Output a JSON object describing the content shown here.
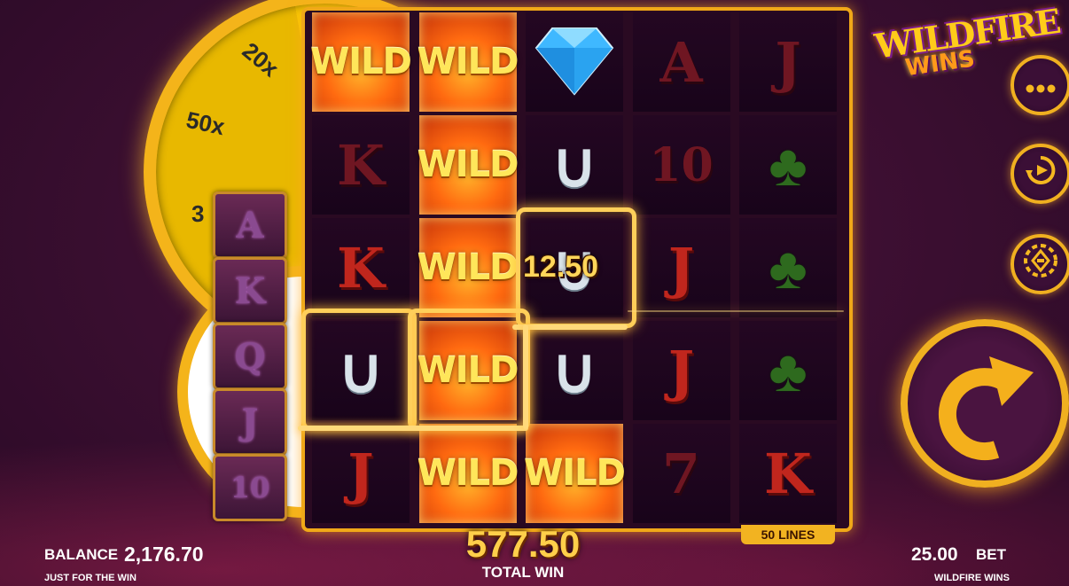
{
  "wheel": {
    "labels": [
      "20x",
      "50x",
      "3"
    ]
  },
  "upgrade_symbols": [
    "A",
    "K",
    "Q",
    "J",
    "10"
  ],
  "reels": [
    [
      "WILD",
      "K",
      "K",
      "U",
      "J"
    ],
    [
      "WILD",
      "WILD",
      "WILD",
      "WILD",
      "WILD"
    ],
    [
      "diamond",
      "U",
      "U",
      "U",
      "WILD"
    ],
    [
      "A",
      "10",
      "J",
      "J",
      "7"
    ],
    [
      "J",
      "clover",
      "clover",
      "clover",
      "K"
    ]
  ],
  "line_win": "12.50",
  "lines_badge": "50 LINES",
  "logo": {
    "top": "WILDFIRE",
    "bottom": "WINS"
  },
  "footer": {
    "balance_label": "BALANCE",
    "balance_value": "2,176.70",
    "subtitle": "JUST FOR THE WIN",
    "total_win_value": "577.50",
    "total_win_label": "TOTAL WIN",
    "bet_value": "25.00",
    "bet_label": "BET",
    "game_name": "WILDFIRE WINS"
  },
  "colors": {
    "accent": "#f0b020",
    "background": "#3d0f32",
    "win_text": "#ffcf4a"
  },
  "icons": [
    "menu-icon",
    "autoplay-icon",
    "bet-chip-icon",
    "spin-icon"
  ]
}
